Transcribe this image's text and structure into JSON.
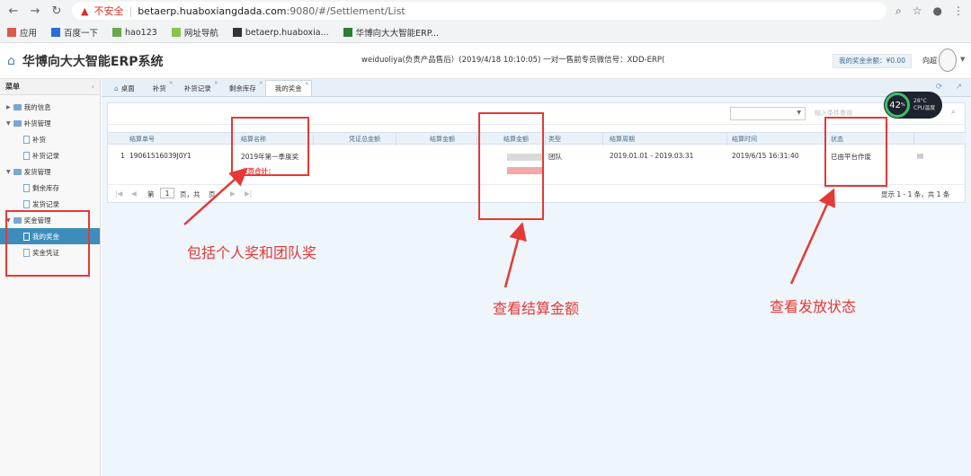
{
  "browser": {
    "warning": "不安全",
    "url_host": "betaerp.huaboxiangdada.com",
    "url_rest": ":9080/#/Settlement/List",
    "bookmarks": [
      "应用",
      "百度一下",
      "hao123",
      "网址导航",
      "betaerp.huaboxia...",
      "华博向大大智能ERP..."
    ]
  },
  "header": {
    "title": "华博向大大智能ERP系统",
    "marquee": "weiduoliya(负责产品售后）(2019/4/18 10:10:05) 一对一售前专员微信号：XDD-ERP(",
    "bonus_balance": "我的奖金余额：¥0.00",
    "username": "向超"
  },
  "sidebar": {
    "title": "菜单",
    "collapse_icon": "chevron-left-icon",
    "groups": [
      {
        "label": "我的信息",
        "expanded": false,
        "children": []
      },
      {
        "label": "补货管理",
        "expanded": true,
        "children": [
          "补货",
          "补货记录"
        ]
      },
      {
        "label": "发货管理",
        "expanded": true,
        "children": [
          "剩余库存",
          "发货记录"
        ]
      },
      {
        "label": "奖金管理",
        "expanded": true,
        "children": [
          "我的奖金",
          "奖金凭证"
        ]
      }
    ],
    "active_item": "我的奖金"
  },
  "tabs": [
    {
      "label": "桌面",
      "closable": false,
      "active": false
    },
    {
      "label": "补货",
      "closable": true,
      "active": false
    },
    {
      "label": "补货记录",
      "closable": true,
      "active": false
    },
    {
      "label": "剩余库存",
      "closable": true,
      "active": false
    },
    {
      "label": "我的奖金",
      "closable": true,
      "active": true
    }
  ],
  "toolbar": {
    "search_placeholder": "输入条件查询"
  },
  "table": {
    "columns": [
      "结算单号",
      "结算名称",
      "凭证总金额",
      "结算金额",
      "结算金额",
      "类型",
      "结算周期",
      "结算时间",
      "状态"
    ],
    "rows": [
      {
        "index": "1",
        "number": "19061516039J0Y1",
        "name": "2019年第一季度奖",
        "voucher_total": "",
        "settle_amount": "",
        "amount_blurred": true,
        "type": "团队",
        "period": "2019.01.01 - 2019.03.31",
        "time": "2019/6/15 16:31:40",
        "status": "已由平台作废"
      }
    ],
    "page_total_label": "本页合计："
  },
  "pager": {
    "page_label": "第",
    "page_value": "1",
    "page_suffix": "页，共",
    "page_total_suffix": "页",
    "summary": "显示 1 - 1 条，共 1 条"
  },
  "cpu_widget": {
    "percent": "42",
    "percent_unit": "%",
    "temp": "28°C",
    "label": "CPU温度"
  },
  "annotations": {
    "note_bonus_types": "包括个人奖和团队奖",
    "note_amount": "查看结算金额",
    "note_status": "查看发放状态"
  },
  "colors": {
    "annotation_red": "#e53935",
    "active_blue": "#3c8dbc"
  }
}
